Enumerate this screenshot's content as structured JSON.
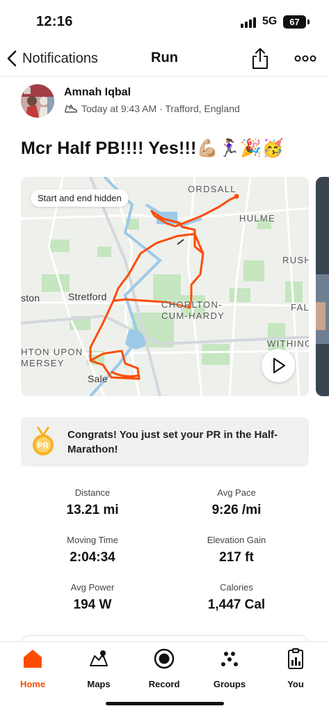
{
  "status_bar": {
    "time": "12:16",
    "network": "5G",
    "battery": "67"
  },
  "nav": {
    "back_label": "Notifications",
    "title": "Run"
  },
  "post": {
    "athlete": "Amnah Iqbal",
    "meta": "Today at 9:43 AM · Trafford, England",
    "title": "Mcr Half PB!!!! Yes!!!💪🏼🏃🏽‍♀️🎉🥳"
  },
  "map": {
    "hidden_label": "Start and end hidden",
    "labels": {
      "ordsall": "ORDSALL",
      "hulme": "HULME",
      "rush": "RUSH",
      "stretford": "Stretford",
      "ston": "ston",
      "chorlton1": "CHORLTON-",
      "chorlton2": "CUM-HARDY",
      "fal": "FAL",
      "withing": "WITHING",
      "upon": "HTON UPON",
      "mersey": "MERSEY",
      "sale": "Sale"
    },
    "route_color": "#fc4c02"
  },
  "pr": {
    "text": "Congrats! You just set your PR in the Half-Marathon!",
    "badge": "PR",
    "medal_color": "#f5b324"
  },
  "stats": [
    {
      "label": "Distance",
      "value": "13.21 mi"
    },
    {
      "label": "Avg Pace",
      "value": "9:26 /mi"
    },
    {
      "label": "Moving Time",
      "value": "2:04:34"
    },
    {
      "label": "Elevation Gain",
      "value": "217 ft"
    },
    {
      "label": "Avg Power",
      "value": "194 W"
    },
    {
      "label": "Calories",
      "value": "1,447 Cal"
    }
  ],
  "tabs": [
    {
      "label": "Home",
      "icon": "home-icon",
      "active": true
    },
    {
      "label": "Maps",
      "icon": "maps-icon"
    },
    {
      "label": "Record",
      "icon": "record-icon"
    },
    {
      "label": "Groups",
      "icon": "groups-icon"
    },
    {
      "label": "You",
      "icon": "you-icon"
    }
  ],
  "colors": {
    "accent": "#fc4c02",
    "banner_bg": "#f0f0ee"
  }
}
